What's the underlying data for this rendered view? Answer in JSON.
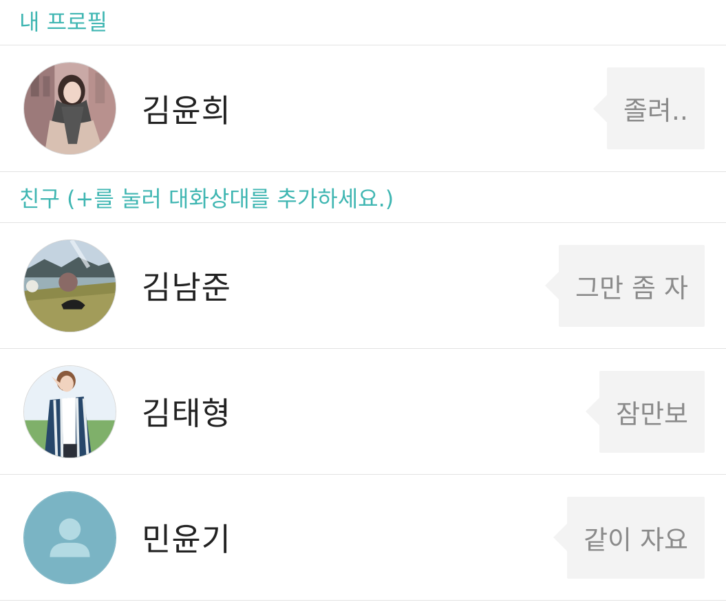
{
  "my_profile": {
    "header": "내 프로필",
    "name": "김윤희",
    "status": "졸려..",
    "avatar_icon": "profile-photo-woman-scarf"
  },
  "friends": {
    "header": "친구 (+를 눌러 대화상대를 추가하세요.)",
    "items": [
      {
        "name": "김남준",
        "status": "그만 좀 자",
        "avatar_icon": "profile-photo-landscape"
      },
      {
        "name": "김태형",
        "status": "잠만보",
        "avatar_icon": "profile-photo-striped-jacket"
      },
      {
        "name": "민윤기",
        "status": "같이 자요",
        "avatar_icon": "default-person-icon"
      }
    ]
  },
  "colors": {
    "accent": "#3fb6b2",
    "bubble_bg": "#f3f3f3",
    "bubble_text": "#8a8a8a",
    "default_avatar_bg": "#7ab4c4"
  }
}
